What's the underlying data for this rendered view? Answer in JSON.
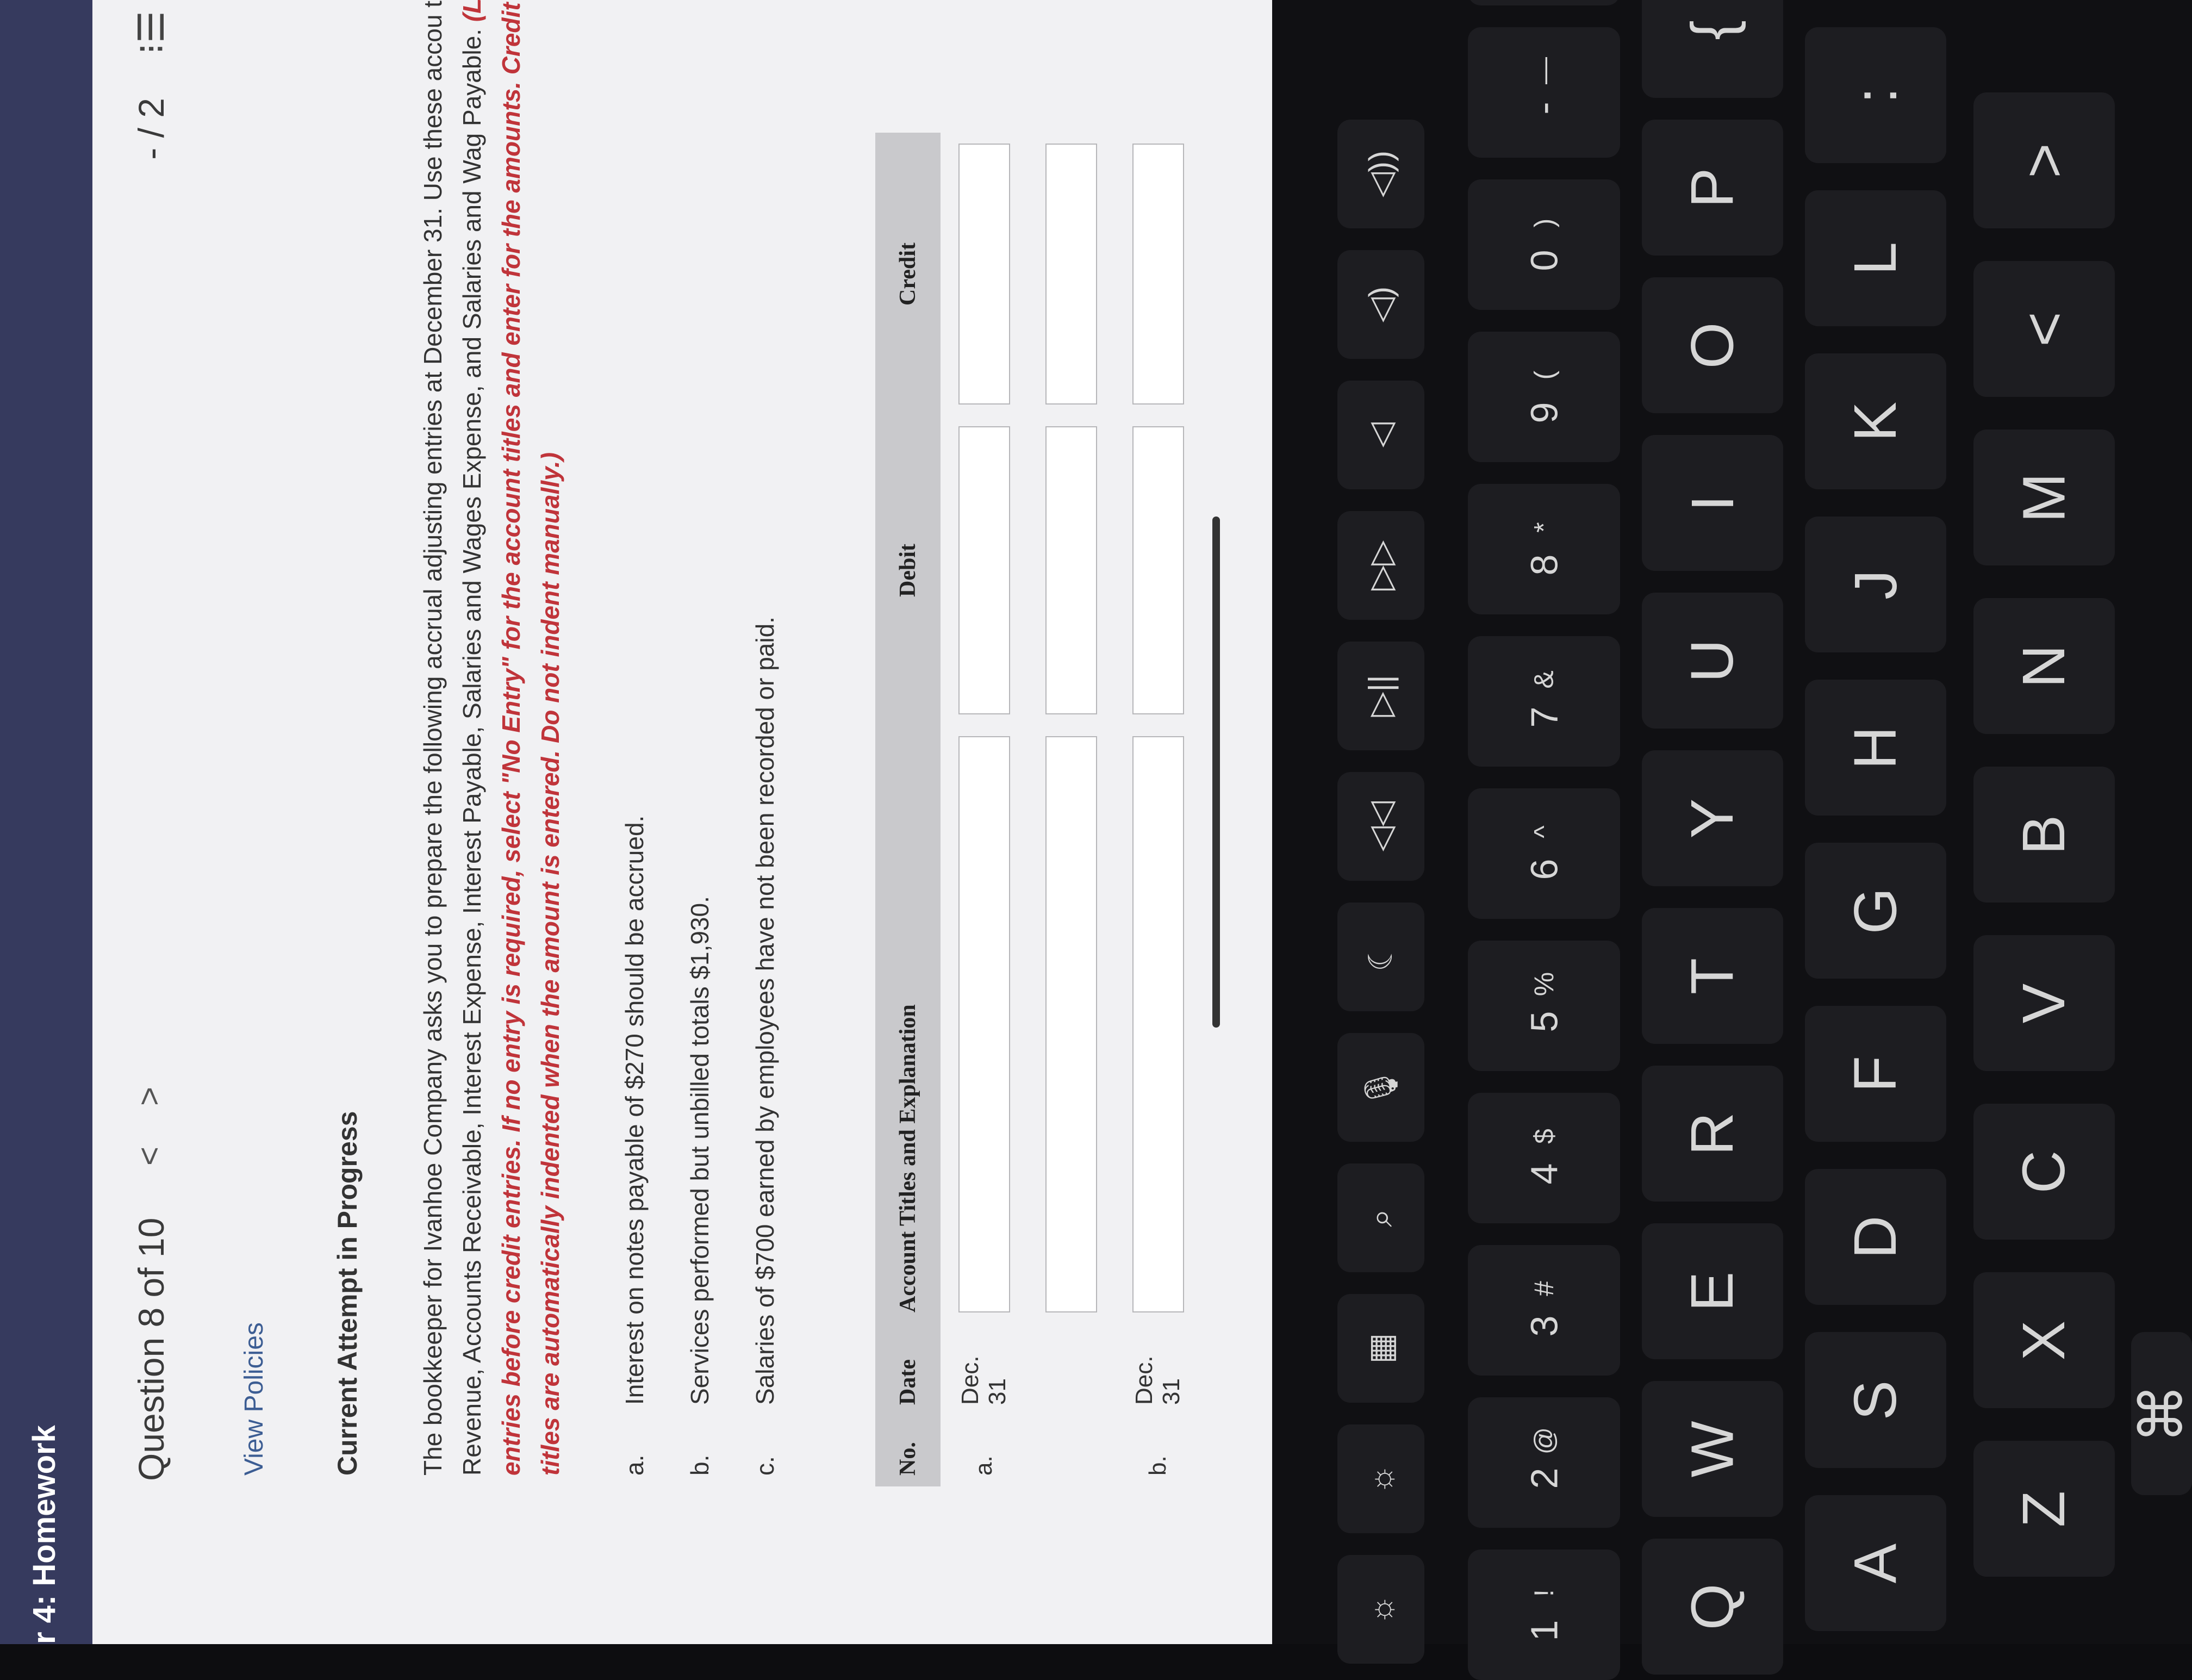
{
  "header": {
    "title": "r 4: Homework"
  },
  "question_nav": {
    "label": "Question 8 of 10",
    "prev": "<",
    "next": ">",
    "pager": "- / 2",
    "list_icon": "⁝☰"
  },
  "view_policies": "View Policies",
  "attempt_status": "Current Attempt in Progress",
  "instructions": {
    "plain": "The bookkeeper for Ivanhoe Company asks you to prepare the following accrual adjusting entries at December 31. Use these accou titles: Service Revenue, Accounts Receivable, Interest Expense, Interest Payable, Salaries and Wages Expense, and Salaries and Wag Payable. ",
    "emphasis": "(List all debit entries before credit entries. If no entry is required, select \"No Entry\" for the account titles and enter for the amounts. Credit account titles are automatically indented when the amount is entered. Do not indent manually.)"
  },
  "items": [
    {
      "letter": "a.",
      "text": "Interest on notes payable of $270 should be accrued."
    },
    {
      "letter": "b.",
      "text": "Services performed but unbilled totals $1,930."
    },
    {
      "letter": "c.",
      "text": "Salaries of $700 earned by employees have not been recorded or paid."
    }
  ],
  "table": {
    "headers": {
      "no": "No.",
      "date": "Date",
      "account": "Account Titles and Explanation",
      "debit": "Debit",
      "credit": "Credit"
    },
    "rows": [
      {
        "no": "a.",
        "date": "Dec. 31"
      },
      {
        "no": "",
        "date": ""
      },
      {
        "no": "b.",
        "date": "Dec. 31"
      }
    ]
  },
  "keyboard": {
    "fn_row": [
      "☼",
      "☼",
      "▦",
      "⌕",
      "🎙",
      "☾",
      "◁◁",
      "▷||",
      "▷▷",
      "◁",
      "◁)",
      "◁))"
    ],
    "num_top": [
      "!",
      "@",
      "#",
      "$",
      "%",
      "^",
      "&",
      "*",
      "(",
      ")",
      "—",
      "+"
    ],
    "num_bottom": [
      "1",
      "2",
      "3",
      "4",
      "5",
      "6",
      "7",
      "8",
      "9",
      "0",
      "-",
      "="
    ],
    "qwerty": [
      "Q",
      "W",
      "E",
      "R",
      "T",
      "Y",
      "U",
      "I",
      "O",
      "P",
      "{"
    ],
    "asdf": [
      "A",
      "S",
      "D",
      "F",
      "G",
      "H",
      "J",
      "K",
      "L",
      ":"
    ],
    "zxcv": [
      "Z",
      "X",
      "C",
      "V",
      "B",
      "N",
      "M",
      "<",
      ">"
    ],
    "cmd": "⌘"
  }
}
